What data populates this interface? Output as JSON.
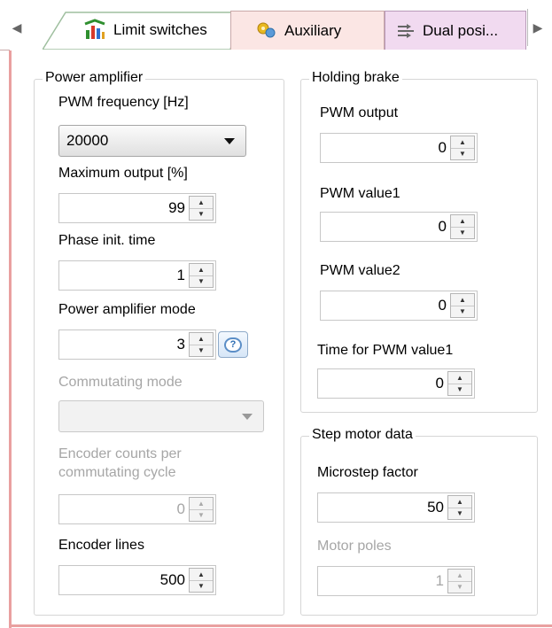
{
  "tabs": {
    "scroll_left": "◀",
    "scroll_right": "▶",
    "items": [
      {
        "label": "Limit switches",
        "icon": "limit-switches-icon"
      },
      {
        "label": "Auxiliary",
        "icon": "auxiliary-icon"
      },
      {
        "label": "Dual posi...",
        "icon": "dual-position-icon"
      }
    ]
  },
  "power_amplifier": {
    "title": "Power amplifier",
    "pwm_frequency": {
      "label": "PWM frequency [Hz]",
      "value": "20000"
    },
    "maximum_output": {
      "label": "Maximum output [%]",
      "value": "99"
    },
    "phase_init_time": {
      "label": "Phase init. time",
      "value": "1"
    },
    "power_amplifier_mode": {
      "label": "Power amplifier mode",
      "value": "3"
    },
    "commutating_mode": {
      "label": "Commutating mode",
      "value": ""
    },
    "encoder_counts": {
      "label_line1": "Encoder counts per",
      "label_line2": "commutating cycle",
      "value": "0"
    },
    "encoder_lines": {
      "label": "Encoder lines",
      "value": "500"
    }
  },
  "holding_brake": {
    "title": "Holding brake",
    "pwm_output": {
      "label": "PWM output",
      "value": "0"
    },
    "pwm_value1": {
      "label": "PWM value1",
      "value": "0"
    },
    "pwm_value2": {
      "label": "PWM value2",
      "value": "0"
    },
    "time_for_pwm_value1": {
      "label": "Time for PWM value1",
      "value": "0"
    }
  },
  "step_motor": {
    "title": "Step motor data",
    "microstep_factor": {
      "label": "Microstep factor",
      "value": "50"
    },
    "motor_poles": {
      "label": "Motor poles",
      "value": "1"
    }
  },
  "colors": {
    "panel_border": "#e9a0a0",
    "aux_tab_bg": "#fbe6e4",
    "dual_tab_bg": "#f1daf0"
  }
}
